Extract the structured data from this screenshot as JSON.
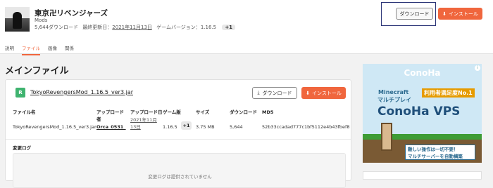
{
  "project": {
    "title": "東京卍リベンジャーズ",
    "category": "Mods",
    "downloads": "5,644ダウンロード",
    "updated_label": "最終更新日：",
    "updated_date": "2021年11月13日",
    "game_version_label": "ゲームバージョン：",
    "game_version": "1.16.5",
    "extra_versions": "+1"
  },
  "header_buttons": {
    "download": "ダウンロード",
    "install": "インストール"
  },
  "tabs": [
    "説明",
    "ファイル",
    "画像",
    "関係"
  ],
  "active_tab": "ファイル",
  "section_title": "メインファイル",
  "file": {
    "badge": "R",
    "name": "TokyoRevengersMod_1.16.5_ver3.jar",
    "download": "ダウンロード",
    "install": "インストール"
  },
  "table": {
    "headers": {
      "filename": "ファイル名",
      "uploader": "アップロード者",
      "upload_date": "アップロード日",
      "game_version": "ゲーム版",
      "size": "サイズ",
      "downloads": "ダウンロード",
      "md5": "MD5"
    },
    "row": {
      "filename": "TokyoRevengersMod_1.16.5_ver3.jar",
      "uploader": "Orca_0531_",
      "upload_date_1": "2021年11月",
      "upload_date_2": "13日",
      "game_version": "1.16.5",
      "extra_versions": "+1",
      "size": "3.75 MB",
      "downloads": "5,644",
      "md5": "52b33ccadad777c1bf5112e4b43fbef8"
    }
  },
  "changelog": {
    "title": "変更ログ",
    "empty": "変更ログは提供されていません"
  },
  "ad": {
    "logo": "ConoHa",
    "line1": "Minecraft",
    "line2": "マルチプレイ",
    "badge": "利用者満足度No.1",
    "brand": "ConoHa VPS",
    "strip1": "難しい操作は一切不要！",
    "strip2": "マルチサーバーを自動構築",
    "info": "i"
  },
  "colors": {
    "accent": "#f0663d",
    "badge_green": "#3fb36f",
    "highlight_box": "#2c3678"
  }
}
